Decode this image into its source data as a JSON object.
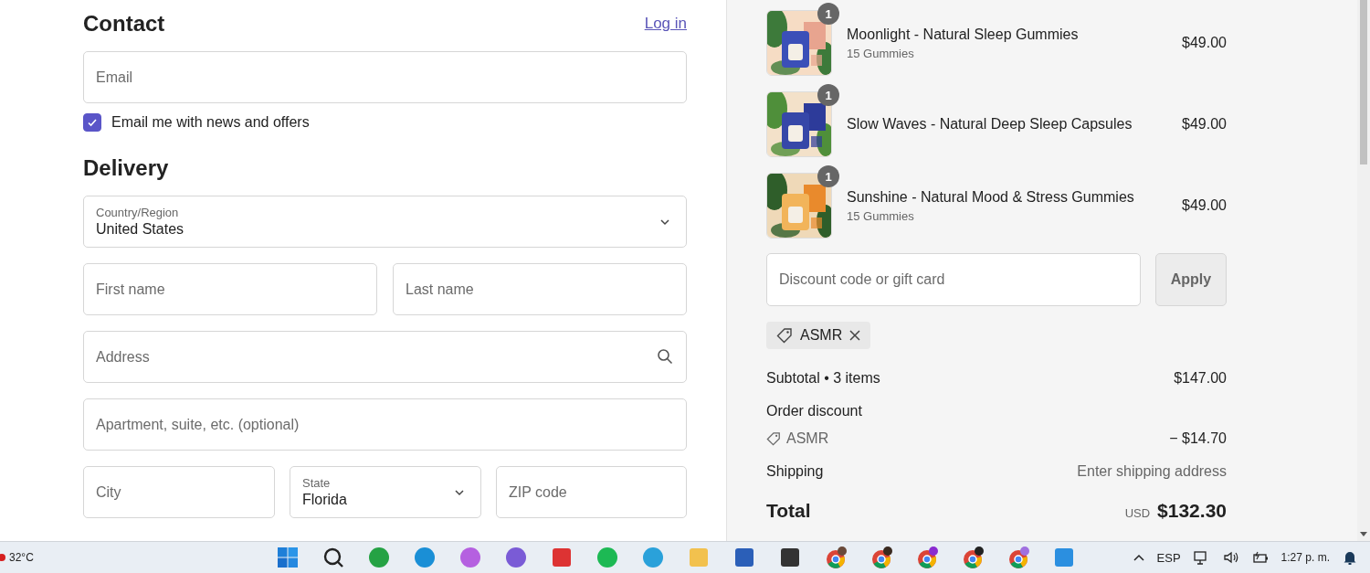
{
  "contact": {
    "heading": "Contact",
    "login_link": "Log in",
    "email": {
      "placeholder": "Email"
    },
    "newsletter": {
      "label": "Email me with news and offers",
      "checked": true
    }
  },
  "delivery": {
    "heading": "Delivery",
    "country": {
      "label": "Country/Region",
      "value": "United States"
    },
    "first_name": {
      "placeholder": "First name"
    },
    "last_name": {
      "placeholder": "Last name"
    },
    "address": {
      "placeholder": "Address"
    },
    "apartment": {
      "placeholder": "Apartment, suite, etc. (optional)"
    },
    "city": {
      "placeholder": "City"
    },
    "state": {
      "label": "State",
      "value": "Florida"
    },
    "zip": {
      "placeholder": "ZIP code"
    }
  },
  "order": {
    "items": [
      {
        "quantity": "1",
        "name": "Moonlight - Natural Sleep Gummies",
        "variant": "15 Gummies",
        "price": "$49.00"
      },
      {
        "quantity": "1",
        "name": "Slow Waves - Natural Deep Sleep Capsules",
        "price": "$49.00"
      },
      {
        "quantity": "1",
        "name": "Sunshine - Natural Mood & Stress Gummies",
        "variant": "15 Gummies",
        "price": "$49.00"
      }
    ],
    "discount": {
      "placeholder": "Discount code or gift card",
      "button": "Apply"
    },
    "applied_code": "ASMR",
    "subtotal": {
      "label": "Subtotal • 3 items",
      "value": "$147.00"
    },
    "order_discount": {
      "label": "Order discount",
      "code": "ASMR",
      "value": "− $14.70"
    },
    "shipping": {
      "label": "Shipping",
      "value": "Enter shipping address"
    },
    "total": {
      "label": "Total",
      "currency": "USD",
      "value": "$132.30"
    }
  },
  "taskbar": {
    "weather": "32°C",
    "language": "ESP",
    "time": "1:27 p. m."
  }
}
